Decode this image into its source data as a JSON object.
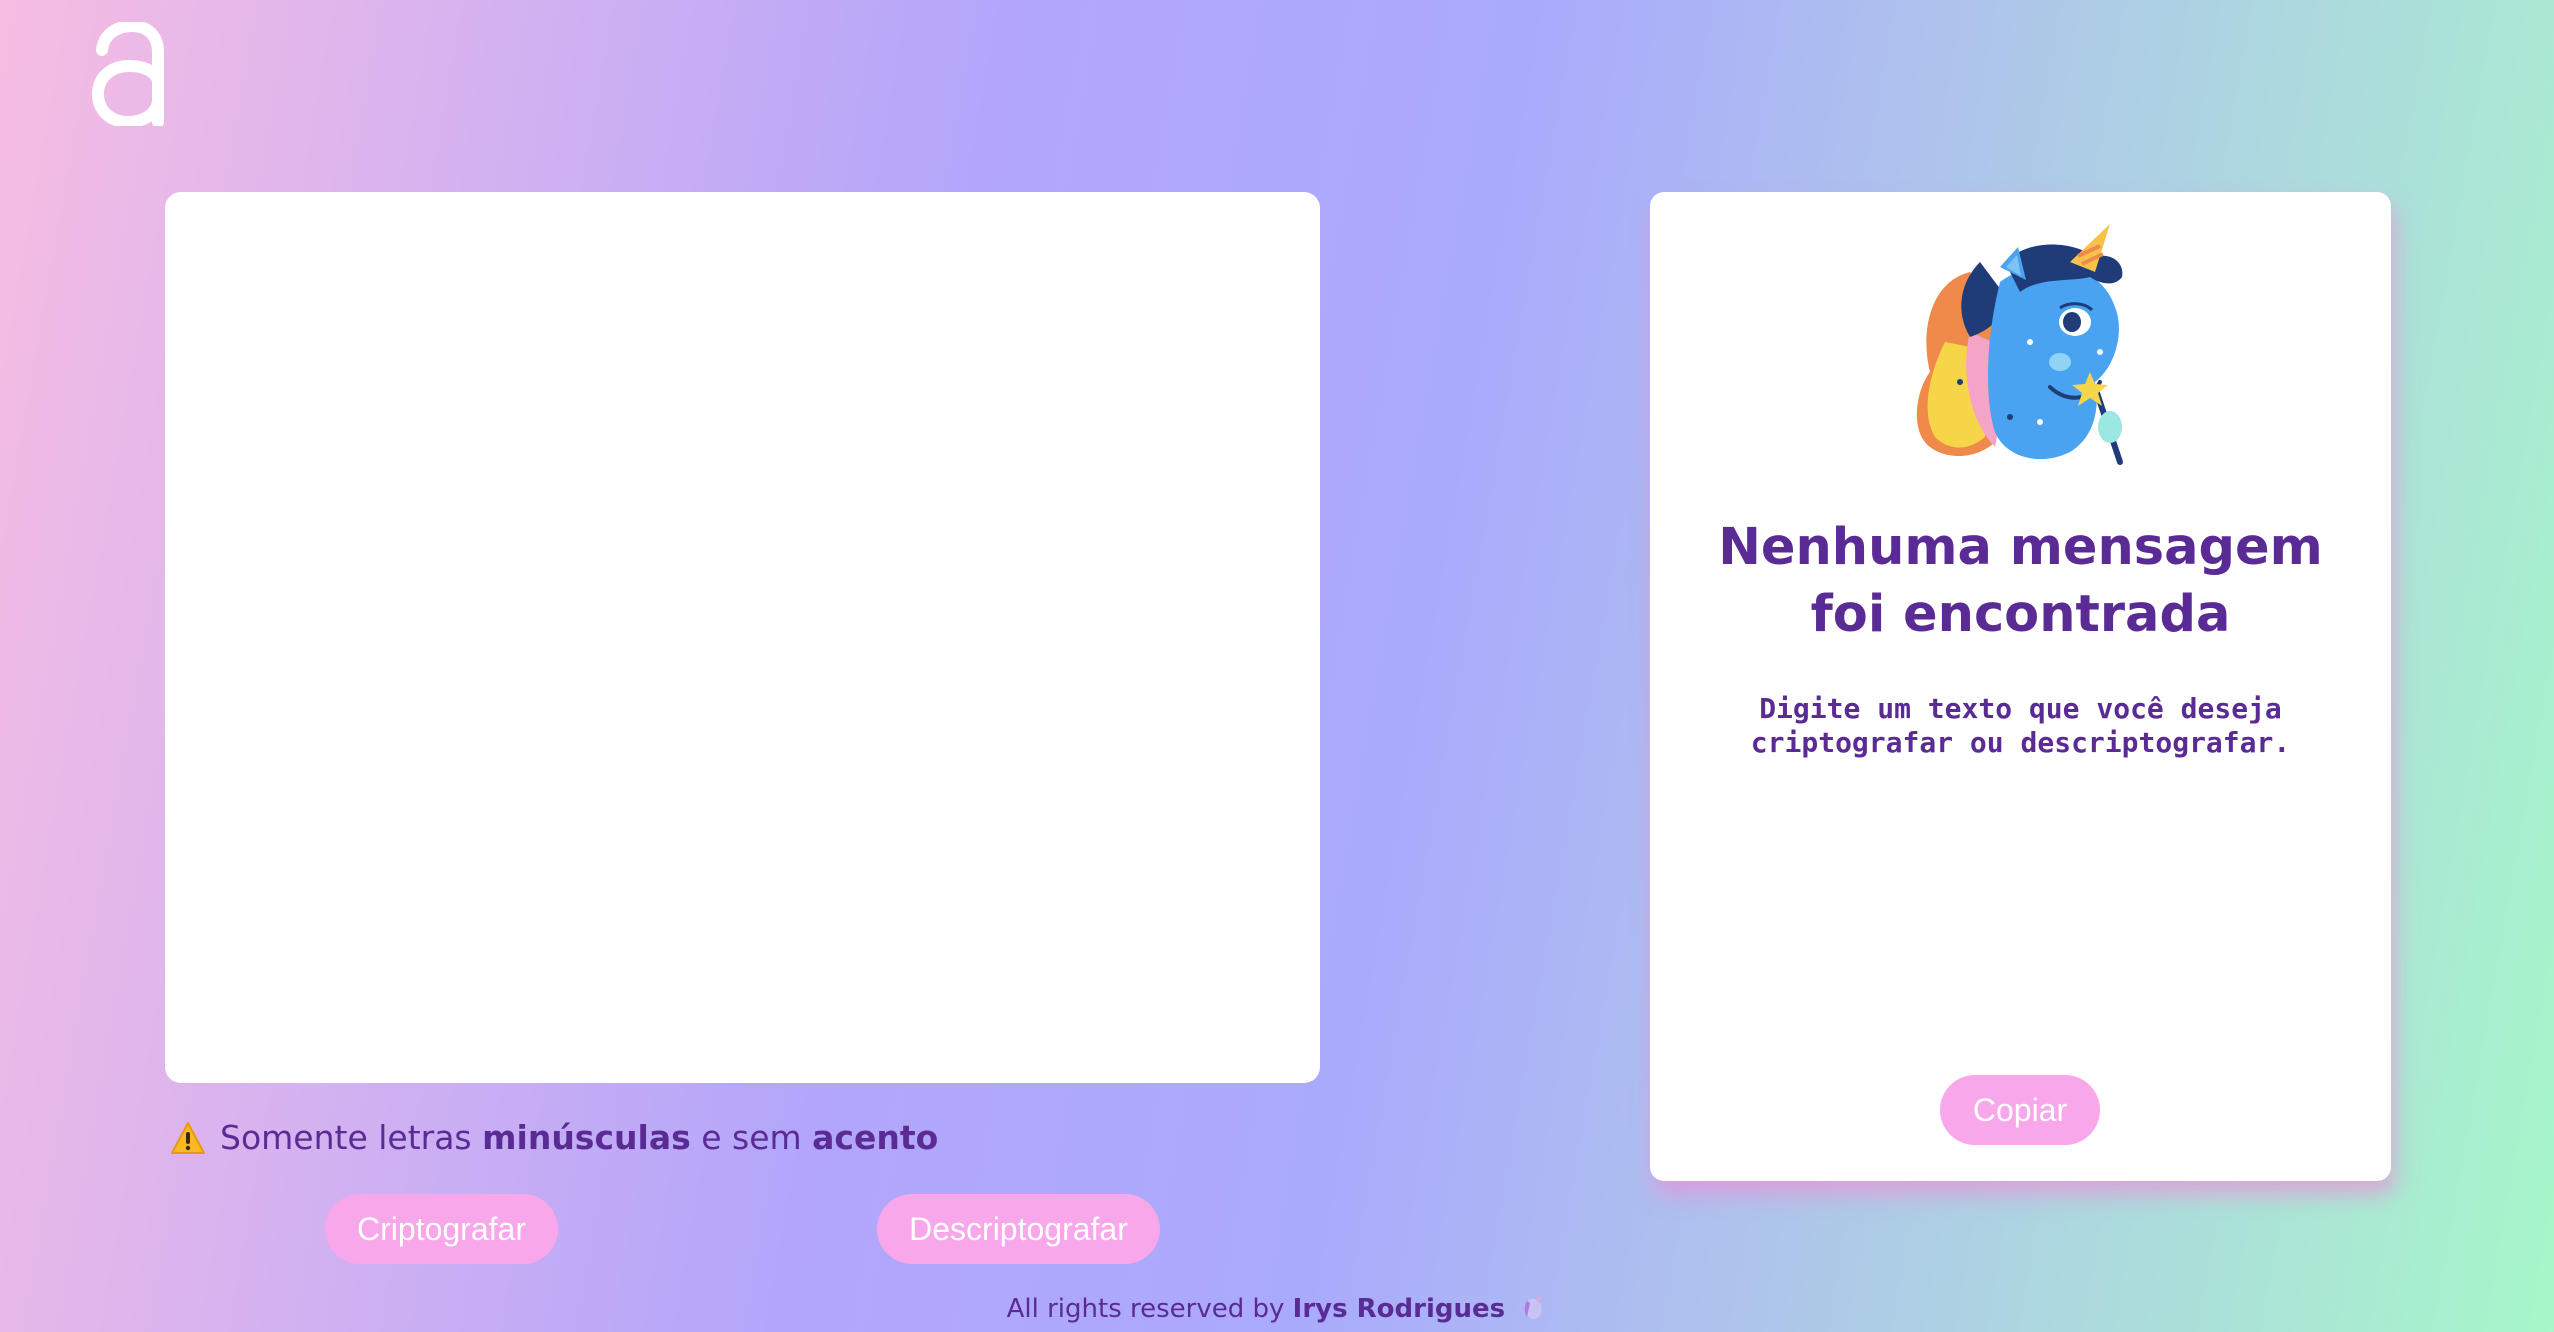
{
  "header": {
    "logo_icon": "alura-a-logo-icon"
  },
  "input": {
    "placeholder": "",
    "value": ""
  },
  "warning": {
    "icon": "warning-icon",
    "text_1": "Somente letras ",
    "bold_1": "minúsculas",
    "text_2": " e sem ",
    "bold_2": "acento"
  },
  "buttons": {
    "encrypt": "Criptografar",
    "decrypt": "Descriptografar",
    "copy": "Copiar"
  },
  "output": {
    "illustration": "unicorn-illustration",
    "title": "Nenhuma mensagem foi encontrada",
    "subtitle": "Digite um texto que você deseja criptografar ou descriptografar."
  },
  "footer": {
    "prefix": "All rights reserved by ",
    "author": "Irys Rodrigues",
    "icon": "unicorn-icon"
  },
  "colors": {
    "primary_text": "#5b2b95",
    "button_bg": "#f7a7ea",
    "button_text": "#ffffff"
  }
}
